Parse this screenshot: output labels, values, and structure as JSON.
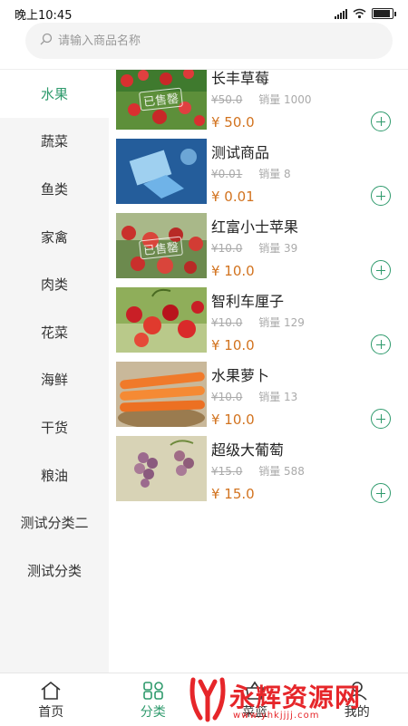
{
  "status_bar": {
    "time": "晚上10:45"
  },
  "search": {
    "placeholder": "请输入商品名称"
  },
  "sidebar": {
    "categories": [
      "水果",
      "蔬菜",
      "鱼类",
      "家禽",
      "肉类",
      "花菜",
      "海鲜",
      "干货",
      "粮油",
      "测试分类二",
      "测试分类"
    ],
    "active_index": 0
  },
  "products": [
    {
      "name": "长丰草莓",
      "original_price": "¥50.0",
      "sales": "销量 1000",
      "price": "¥ 50.0",
      "sold_out_label": "已售罄",
      "image": "strawberry"
    },
    {
      "name": "测试商品",
      "original_price": "¥0.01",
      "sales": "销量 8",
      "price": "¥ 0.01",
      "sold_out_label": "",
      "image": "tech"
    },
    {
      "name": "红富小士苹果",
      "original_price": "¥10.0",
      "sales": "销量 39",
      "price": "¥ 10.0",
      "sold_out_label": "已售罄",
      "image": "apple"
    },
    {
      "name": "智利车厘子",
      "original_price": "¥10.0",
      "sales": "销量 129",
      "price": "¥ 10.0",
      "sold_out_label": "",
      "image": "cherry"
    },
    {
      "name": "水果萝卜",
      "original_price": "¥10.0",
      "sales": "销量 13",
      "price": "¥ 10.0",
      "sold_out_label": "",
      "image": "carrot"
    },
    {
      "name": "超级大葡萄",
      "original_price": "¥15.0",
      "sales": "销量 588",
      "price": "¥ 15.0",
      "sold_out_label": "",
      "image": "grape"
    }
  ],
  "tabbar": {
    "tabs": [
      {
        "label": "首页",
        "icon": "home-icon"
      },
      {
        "label": "分类",
        "icon": "category-icon"
      },
      {
        "label": "菜篮",
        "icon": "basket-icon"
      },
      {
        "label": "我的",
        "icon": "profile-icon"
      }
    ],
    "active_index": 1
  },
  "watermark": {
    "text": "永辉资源网",
    "url": "www.yhkjjjj.com"
  },
  "colors": {
    "accent": "#2e9a6c",
    "price": "#d2731f"
  }
}
